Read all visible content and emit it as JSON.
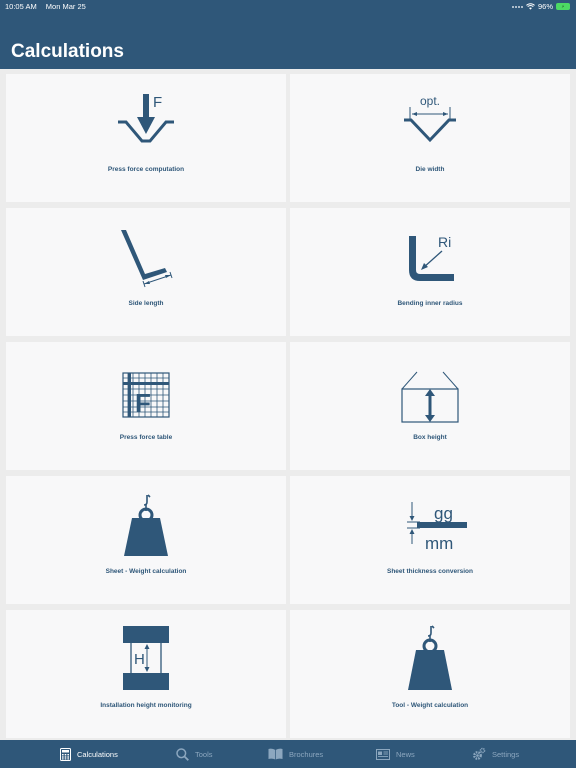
{
  "status_bar": {
    "time": "10:05 AM",
    "date": "Mon Mar 25",
    "battery_percent": "96%"
  },
  "header": {
    "title": "Calculations"
  },
  "tiles": [
    {
      "label": "Press force computation",
      "icon": "press-force-icon",
      "icon_text": "F"
    },
    {
      "label": "Die width",
      "icon": "die-width-icon",
      "icon_text": "opt."
    },
    {
      "label": "Side length",
      "icon": "side-length-icon"
    },
    {
      "label": "Bending inner radius",
      "icon": "inner-radius-icon",
      "icon_text": "Ri"
    },
    {
      "label": "Press force table",
      "icon": "press-force-table-icon",
      "icon_text": "F"
    },
    {
      "label": "Box height",
      "icon": "box-height-icon"
    },
    {
      "label": "Sheet - Weight calculation",
      "icon": "weight-icon"
    },
    {
      "label": "Sheet thickness conversion",
      "icon": "thickness-icon",
      "icon_text_top": "gg",
      "icon_text_bottom": "mm"
    },
    {
      "label": "Installation height monitoring",
      "icon": "install-height-icon",
      "icon_text": "H"
    },
    {
      "label": "Tool - Weight calculation",
      "icon": "tool-weight-icon"
    }
  ],
  "tab_bar": {
    "items": [
      {
        "label": "Calculations",
        "icon": "calculator-icon",
        "active": true
      },
      {
        "label": "Tools",
        "icon": "search-icon",
        "active": false
      },
      {
        "label": "Brochures",
        "icon": "book-icon",
        "active": false
      },
      {
        "label": "News",
        "icon": "news-icon",
        "active": false
      },
      {
        "label": "Settings",
        "icon": "gear-icon",
        "active": false
      }
    ]
  },
  "colors": {
    "primary": "#2f5779",
    "tile_bg": "#f8f8f9",
    "page_bg": "#ececec",
    "tab_inactive": "#8ca7bf"
  }
}
